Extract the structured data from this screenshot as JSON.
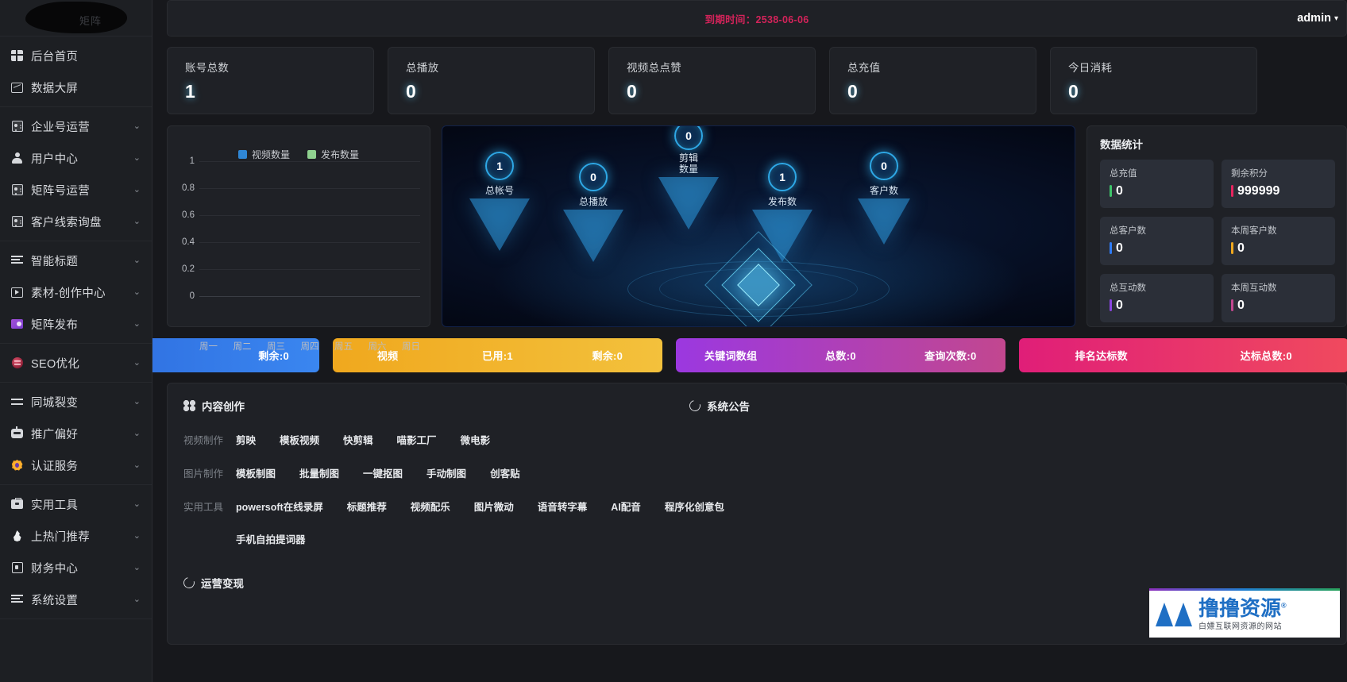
{
  "sidebar": {
    "logo_ghost": "矩阵",
    "groups": [
      {
        "items": [
          {
            "label": "后台首页",
            "icon": "grid-icon",
            "caret": false
          },
          {
            "label": "数据大屏",
            "icon": "chart-frame-icon",
            "caret": false
          }
        ]
      },
      {
        "items": [
          {
            "label": "企业号运营",
            "icon": "id-card-icon",
            "caret": true
          },
          {
            "label": "用户中心",
            "icon": "person-icon",
            "caret": true
          },
          {
            "label": "矩阵号运营",
            "icon": "id-card-icon",
            "caret": true
          },
          {
            "label": "客户线索询盘",
            "icon": "card-icon",
            "caret": true
          }
        ]
      },
      {
        "items": [
          {
            "label": "智能标题",
            "icon": "lines-icon",
            "caret": true
          },
          {
            "label": "素材-创作中心",
            "icon": "play-frame-icon",
            "caret": true
          },
          {
            "label": "矩阵发布",
            "icon": "send-icon",
            "caret": true
          }
        ]
      },
      {
        "items": [
          {
            "label": "SEO优化",
            "icon": "seo-icon",
            "caret": true
          }
        ]
      },
      {
        "items": [
          {
            "label": "同城裂变",
            "icon": "swap-icon",
            "caret": true
          },
          {
            "label": "推广偏好",
            "icon": "robot-icon",
            "caret": true
          },
          {
            "label": "认证服务",
            "icon": "verified-badge-icon",
            "caret": true
          }
        ]
      },
      {
        "items": [
          {
            "label": "实用工具",
            "icon": "briefcase-icon",
            "caret": true
          },
          {
            "label": "上热门推荐",
            "icon": "fire-icon",
            "caret": true
          },
          {
            "label": "财务中心",
            "icon": "wallet-icon",
            "caret": true
          },
          {
            "label": "系统设置",
            "icon": "gear-icon",
            "caret": true
          }
        ]
      }
    ]
  },
  "topbar": {
    "expire_text": "到期时间：2538-06-06",
    "expire_color": "#d3235a",
    "admin_label": "admin",
    "admin_caret": "▾"
  },
  "stat_cards": [
    {
      "title": "账号总数",
      "value": "1"
    },
    {
      "title": "总播放",
      "value": "0"
    },
    {
      "title": "视频总点赞",
      "value": "0"
    },
    {
      "title": "总充值",
      "value": "0"
    },
    {
      "title": "今日消耗",
      "value": "0"
    }
  ],
  "chart_data": {
    "type": "bar",
    "title": "",
    "categories": [
      "周一",
      "周二",
      "周三",
      "周四",
      "周五",
      "周六",
      "周日"
    ],
    "series": [
      {
        "name": "视频数量",
        "color": "#2f86d4",
        "values": [
          0,
          0,
          0,
          0,
          0,
          0,
          0
        ]
      },
      {
        "name": "发布数量",
        "color": "#8fd18f",
        "values": [
          0,
          0,
          0,
          0,
          0,
          0,
          0
        ]
      }
    ],
    "yticks": [
      "1",
      "0.8",
      "0.6",
      "0.4",
      "0.2",
      "0"
    ],
    "ylim": [
      0,
      1
    ],
    "xlabel": "",
    "ylabel": "",
    "grid": true,
    "legend_position": "top-center"
  },
  "viz": {
    "nodes": [
      {
        "value": "1",
        "name": "总帐号"
      },
      {
        "value": "0",
        "name": "总播放"
      },
      {
        "value": "0",
        "name": "剪辑数量"
      },
      {
        "value": "1",
        "name": "发布数"
      },
      {
        "value": "0",
        "name": "客户数"
      }
    ]
  },
  "stats_panel": {
    "title": "数据统计",
    "items": [
      {
        "label": "总充值",
        "value": "0",
        "color": "#3ec46a"
      },
      {
        "label": "剩余积分",
        "value": "999999",
        "color": "#e8245f"
      },
      {
        "label": "总客户数",
        "value": "0",
        "color": "#2f7cf6"
      },
      {
        "label": "本周客户数",
        "value": "0",
        "color": "#f0a81e"
      },
      {
        "label": "总互动数",
        "value": "0",
        "color": "#8a46e0"
      },
      {
        "label": "本周互动数",
        "value": "0",
        "color": "#c2478f"
      }
    ]
  },
  "bars": [
    {
      "segments": [
        "剩余:0"
      ]
    },
    {
      "segments": [
        "视频",
        "已用:1",
        "剩余:0"
      ]
    },
    {
      "segments": [
        "关键词数组",
        "总数:0",
        "查询次数:0"
      ]
    },
    {
      "segments": [
        "排名达标数",
        "达标总数:0"
      ]
    }
  ],
  "content_panel": {
    "title": "内容创作",
    "notice_title": "系统公告",
    "rows": [
      {
        "category": "视频制作",
        "links": [
          "剪映",
          "模板视频",
          "快剪辑",
          "喵影工厂",
          "微电影"
        ]
      },
      {
        "category": "图片制作",
        "links": [
          "模板制图",
          "批量制图",
          "一键抠图",
          "手动制图",
          "创客贴"
        ]
      },
      {
        "category": "实用工具",
        "links": [
          "powersoft在线录屏",
          "标题推荐",
          "视频配乐",
          "图片微动",
          "语音转字幕",
          "AI配音",
          "程序化创意包"
        ]
      }
    ],
    "extra_links": [
      "手机自拍提词器"
    ],
    "monetize_title": "运营变现"
  },
  "watermark": {
    "main": "撸撸资源",
    "reg": "®",
    "sub": "白嫖互联网资源的网站"
  }
}
